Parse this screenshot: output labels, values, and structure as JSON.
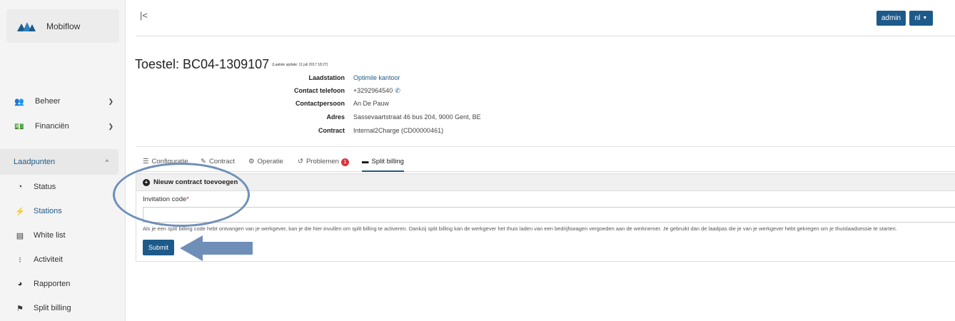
{
  "brand": {
    "name": "Mobiflow",
    "logo_icon": "mobiflow-logo",
    "accent": "#1d5a8a"
  },
  "sidebar": {
    "items": [
      {
        "label": "Beheer",
        "icon": "users-icon"
      },
      {
        "label": "Financiën",
        "icon": "money-icon"
      }
    ],
    "section": {
      "label": "Laadpunten"
    },
    "subitems": [
      {
        "label": "Status",
        "icon": "dashboard-icon"
      },
      {
        "label": "Stations",
        "icon": "charging-station-icon"
      },
      {
        "label": "White list",
        "icon": "list-icon"
      },
      {
        "label": "Activiteit",
        "icon": "spinner-icon"
      },
      {
        "label": "Rapporten",
        "icon": "pie-chart-icon"
      },
      {
        "label": "Split billing",
        "icon": "split-icon"
      }
    ]
  },
  "topbar": {
    "collapse_label": "|<",
    "user_label": "admin",
    "lang_label": "nl"
  },
  "device": {
    "title": "Toestel: BC04-1309107",
    "last_update": "(Laatste update: 11 juli 2017 18:27)",
    "fields": [
      {
        "label": "Laadstation",
        "value": "Optimile kantoor"
      },
      {
        "label": "Contact telefoon",
        "value": "+3292964540"
      },
      {
        "label": "Contactpersoon",
        "value": "An De Pauw"
      },
      {
        "label": "Adres",
        "value": "Sassevaartstraat 46 bus 204, 9000 Gent, BE"
      },
      {
        "label": "Contract",
        "value": "Internal2Charge (CD00000461)"
      }
    ]
  },
  "tabs": [
    {
      "label": "Configuratie",
      "icon": "sliders-icon"
    },
    {
      "label": "Contract",
      "icon": "pencil-icon"
    },
    {
      "label": "Operatie",
      "icon": "cogs-icon"
    },
    {
      "label": "Problemen",
      "icon": "history-icon",
      "badge": "1"
    },
    {
      "label": "Split billing",
      "icon": "card-icon",
      "active": true
    }
  ],
  "form": {
    "header": "Nieuw contract toevoegen",
    "field_label": "Invitation code",
    "required_mark": "*",
    "input_value": "",
    "help_text": "Als je een split billing code hebt ontvangen van je werkgever, kan je die hier invullen om split billing te activeren. Dankzij split billing kan de werkgever het thuis laden van een bedrijfswagen vergoeden aan de werknemer. Je gebruikt dan de laadpas die je van je werkgever hebt gekregen om je thuislaadsessie te starten.",
    "submit_label": "Submit"
  },
  "colors": {
    "primary": "#1d5a8a",
    "badge": "#d9363e",
    "annotation": "#6f8fb8"
  }
}
